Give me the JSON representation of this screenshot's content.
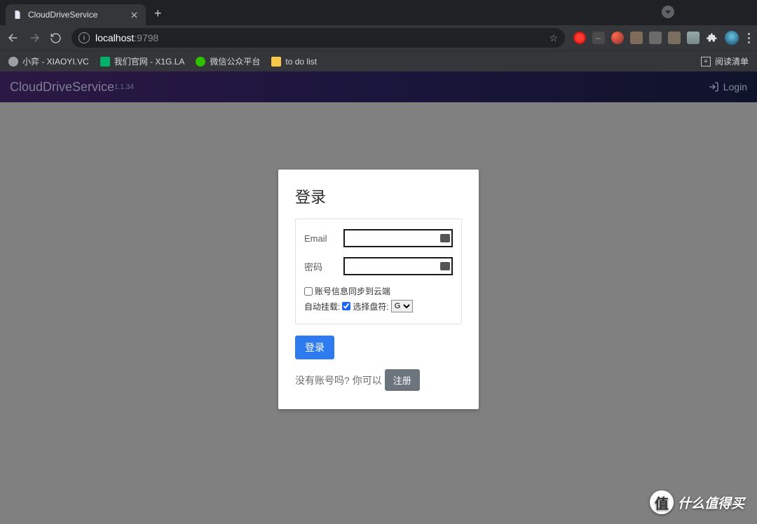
{
  "browser": {
    "tab_title": "CloudDriveService",
    "url_host": "localhost",
    "url_port": ":9798",
    "bookmarks": [
      {
        "label": "小弈 - XIAOYI.VC",
        "color": "#9aa0a6"
      },
      {
        "label": "我们官网 - X1G.LA",
        "color": "#00b16a"
      },
      {
        "label": "微信公众平台",
        "color": "#2dc100"
      },
      {
        "label": "to do list",
        "color": "#f7c948"
      }
    ],
    "reading_list": "阅读清单"
  },
  "app": {
    "brand": "CloudDriveService",
    "version": "1.1.34",
    "login_link": "Login"
  },
  "login": {
    "title": "登录",
    "email_label": "Email",
    "password_label": "密码",
    "sync_label": "账号信息同步到云端",
    "auto_mount_label": "自动挂载:",
    "drive_select_label": "选择盘符:",
    "drive_options": [
      "G"
    ],
    "submit": "登录",
    "no_account_q": "没有账号吗?",
    "you_can": "你可以",
    "register": "注册",
    "sync_checked": false,
    "auto_mount_checked": true
  },
  "watermark": {
    "badge": "值",
    "text": "什么值得买"
  }
}
